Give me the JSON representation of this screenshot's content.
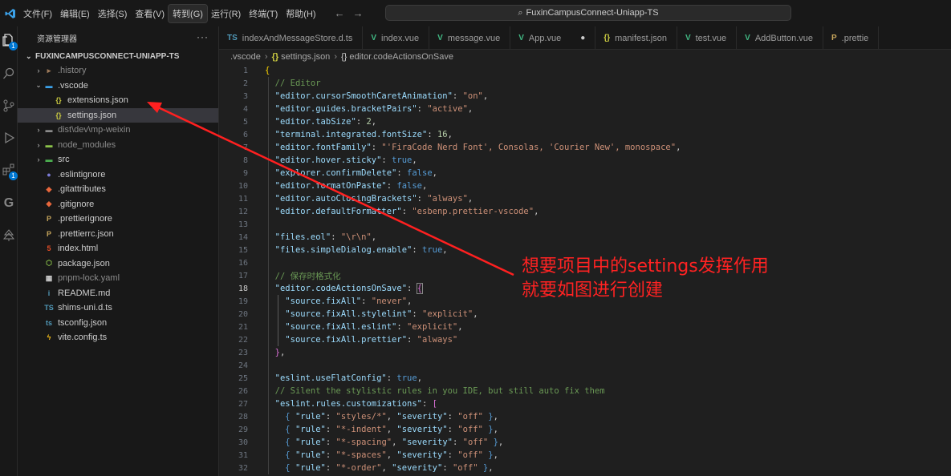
{
  "titlebar": {
    "menu": [
      "文件(F)",
      "编辑(E)",
      "选择(S)",
      "查看(V)",
      "转到(G)",
      "运行(R)",
      "终端(T)",
      "帮助(H)"
    ],
    "active_menu_index": 4,
    "search_text": "FuxinCampusConnect-Uniapp-TS"
  },
  "activitybar": {
    "explorer_badge": "1",
    "extensions_badge": "1"
  },
  "sidebar": {
    "header": "资源管理器",
    "more": "···",
    "project": "FUXINCAMPUSCONNECT-UNIAPP-TS",
    "tree": [
      {
        "label": ".history",
        "icon": "folder-history-icon",
        "level": 1,
        "chev": "›",
        "dim": true
      },
      {
        "label": ".vscode",
        "icon": "folder-vscode-icon",
        "level": 1,
        "chev": "⌄",
        "dim": false
      },
      {
        "label": "extensions.json",
        "icon": "json-braces-icon",
        "level": 2,
        "chev": "",
        "dim": false
      },
      {
        "label": "settings.json",
        "icon": "json-braces-icon",
        "level": 2,
        "chev": "",
        "dim": false,
        "selected": true
      },
      {
        "label": "dist\\dev\\mp-weixin",
        "icon": "folder-icon",
        "level": 1,
        "chev": "›",
        "dim": true
      },
      {
        "label": "node_modules",
        "icon": "folder-node-icon",
        "level": 1,
        "chev": "›",
        "dim": true
      },
      {
        "label": "src",
        "icon": "folder-src-icon",
        "level": 1,
        "chev": "›",
        "dim": false
      },
      {
        "label": ".eslintignore",
        "icon": "eslint-icon",
        "level": 1,
        "chev": "",
        "dim": false
      },
      {
        "label": ".gitattributes",
        "icon": "git-icon",
        "level": 1,
        "chev": "",
        "dim": false
      },
      {
        "label": ".gitignore",
        "icon": "git-icon",
        "level": 1,
        "chev": "",
        "dim": false
      },
      {
        "label": ".prettierignore",
        "icon": "prettier-icon",
        "level": 1,
        "chev": "",
        "dim": false
      },
      {
        "label": ".prettierrc.json",
        "icon": "prettier-icon",
        "level": 1,
        "chev": "",
        "dim": false
      },
      {
        "label": "index.html",
        "icon": "html-icon",
        "level": 1,
        "chev": "",
        "dim": false
      },
      {
        "label": "package.json",
        "icon": "nodejs-icon",
        "level": 1,
        "chev": "",
        "dim": false
      },
      {
        "label": "pnpm-lock.yaml",
        "icon": "pnpm-icon",
        "level": 1,
        "chev": "",
        "dim": true
      },
      {
        "label": "README.md",
        "icon": "info-icon",
        "level": 1,
        "chev": "",
        "dim": false
      },
      {
        "label": "shims-uni.d.ts",
        "icon": "ts-icon",
        "level": 1,
        "chev": "",
        "dim": false
      },
      {
        "label": "tsconfig.json",
        "icon": "tsconfig-icon",
        "level": 1,
        "chev": "",
        "dim": false
      },
      {
        "label": "vite.config.ts",
        "icon": "vite-icon",
        "level": 1,
        "chev": "",
        "dim": false
      }
    ]
  },
  "tabs": [
    {
      "label": "indexAndMessageStore.d.ts",
      "icon": "TS",
      "color": "#519aba"
    },
    {
      "label": "index.vue",
      "icon": "V",
      "color": "#41b883"
    },
    {
      "label": "message.vue",
      "icon": "V",
      "color": "#41b883"
    },
    {
      "label": "App.vue",
      "icon": "V",
      "color": "#41b883",
      "dirty": "●"
    },
    {
      "label": "manifest.json",
      "icon": "{}",
      "color": "#cbcb41"
    },
    {
      "label": "test.vue",
      "icon": "V",
      "color": "#41b883"
    },
    {
      "label": "AddButton.vue",
      "icon": "V",
      "color": "#41b883"
    },
    {
      "label": ".prettie",
      "icon": "P",
      "color": "#c6a55b"
    }
  ],
  "breadcrumb": [
    ".vscode",
    "settings.json",
    "editor.codeActionsOnSave"
  ],
  "editor": {
    "current_line": 18,
    "lines": [
      {
        "n": "1",
        "t": [
          [
            "br",
            "{"
          ]
        ]
      },
      {
        "n": "2",
        "t": [
          [
            "p",
            "  "
          ],
          [
            "c",
            "// Editor"
          ]
        ]
      },
      {
        "n": "3",
        "t": [
          [
            "p",
            "  "
          ],
          [
            "k",
            "\"editor.cursorSmoothCaretAnimation\""
          ],
          [
            "p",
            ": "
          ],
          [
            "s",
            "\"on\""
          ],
          [
            "p",
            ","
          ]
        ]
      },
      {
        "n": "4",
        "t": [
          [
            "p",
            "  "
          ],
          [
            "k",
            "\"editor.guides.bracketPairs\""
          ],
          [
            "p",
            ": "
          ],
          [
            "s",
            "\"active\""
          ],
          [
            "p",
            ","
          ]
        ]
      },
      {
        "n": "5",
        "t": [
          [
            "p",
            "  "
          ],
          [
            "k",
            "\"editor.tabSize\""
          ],
          [
            "p",
            ": "
          ],
          [
            "n",
            "2"
          ],
          [
            "p",
            ","
          ]
        ]
      },
      {
        "n": "6",
        "t": [
          [
            "p",
            "  "
          ],
          [
            "k",
            "\"terminal.integrated.fontSize\""
          ],
          [
            "p",
            ": "
          ],
          [
            "n",
            "16"
          ],
          [
            "p",
            ","
          ]
        ]
      },
      {
        "n": "7",
        "t": [
          [
            "p",
            "  "
          ],
          [
            "k",
            "\"editor.fontFamily\""
          ],
          [
            "p",
            ": "
          ],
          [
            "s",
            "\"'FiraCode Nerd Font', Consolas, 'Courier New', monospace\""
          ],
          [
            "p",
            ","
          ]
        ]
      },
      {
        "n": "8",
        "t": [
          [
            "p",
            "  "
          ],
          [
            "k",
            "\"editor.hover.sticky\""
          ],
          [
            "p",
            ": "
          ],
          [
            "b",
            "true"
          ],
          [
            "p",
            ","
          ]
        ]
      },
      {
        "n": "9",
        "t": [
          [
            "p",
            "  "
          ],
          [
            "k",
            "\"explorer.confirmDelete\""
          ],
          [
            "p",
            ": "
          ],
          [
            "b",
            "false"
          ],
          [
            "p",
            ","
          ]
        ]
      },
      {
        "n": "10",
        "t": [
          [
            "p",
            "  "
          ],
          [
            "k",
            "\"editor.formatOnPaste\""
          ],
          [
            "p",
            ": "
          ],
          [
            "b",
            "false"
          ],
          [
            "p",
            ","
          ]
        ]
      },
      {
        "n": "11",
        "t": [
          [
            "p",
            "  "
          ],
          [
            "k",
            "\"editor.autoClosingBrackets\""
          ],
          [
            "p",
            ": "
          ],
          [
            "s",
            "\"always\""
          ],
          [
            "p",
            ","
          ]
        ]
      },
      {
        "n": "12",
        "t": [
          [
            "p",
            "  "
          ],
          [
            "k",
            "\"editor.defaultFormatter\""
          ],
          [
            "p",
            ": "
          ],
          [
            "s",
            "\"esbenp.prettier-vscode\""
          ],
          [
            "p",
            ","
          ]
        ]
      },
      {
        "n": "13",
        "t": []
      },
      {
        "n": "14",
        "t": [
          [
            "p",
            "  "
          ],
          [
            "k",
            "\"files.eol\""
          ],
          [
            "p",
            ": "
          ],
          [
            "s",
            "\"\\r\\n\""
          ],
          [
            "p",
            ","
          ]
        ]
      },
      {
        "n": "15",
        "t": [
          [
            "p",
            "  "
          ],
          [
            "k",
            "\"files.simpleDialog.enable\""
          ],
          [
            "p",
            ": "
          ],
          [
            "b",
            "true"
          ],
          [
            "p",
            ","
          ]
        ]
      },
      {
        "n": "16",
        "t": []
      },
      {
        "n": "17",
        "t": [
          [
            "p",
            "  "
          ],
          [
            "c",
            "// 保存时格式化"
          ]
        ]
      },
      {
        "n": "18",
        "t": [
          [
            "p",
            "  "
          ],
          [
            "k",
            "\"editor.codeActionsOnSave\""
          ],
          [
            "p",
            ": "
          ],
          [
            "br2",
            "{"
          ]
        ]
      },
      {
        "n": "19",
        "t": [
          [
            "p",
            "    "
          ],
          [
            "k",
            "\"source.fixAll\""
          ],
          [
            "p",
            ": "
          ],
          [
            "s",
            "\"never\""
          ],
          [
            "p",
            ","
          ]
        ]
      },
      {
        "n": "20",
        "t": [
          [
            "p",
            "    "
          ],
          [
            "k",
            "\"source.fixAll.stylelint\""
          ],
          [
            "p",
            ": "
          ],
          [
            "s",
            "\"explicit\""
          ],
          [
            "p",
            ","
          ]
        ]
      },
      {
        "n": "21",
        "t": [
          [
            "p",
            "    "
          ],
          [
            "k",
            "\"source.fixAll.eslint\""
          ],
          [
            "p",
            ": "
          ],
          [
            "s",
            "\"explicit\""
          ],
          [
            "p",
            ","
          ]
        ]
      },
      {
        "n": "22",
        "t": [
          [
            "p",
            "    "
          ],
          [
            "k",
            "\"source.fixAll.prettier\""
          ],
          [
            "p",
            ": "
          ],
          [
            "s",
            "\"always\""
          ]
        ]
      },
      {
        "n": "23",
        "t": [
          [
            "p",
            "  "
          ],
          [
            "br2",
            "}"
          ],
          [
            "p",
            ","
          ]
        ]
      },
      {
        "n": "24",
        "t": []
      },
      {
        "n": "25",
        "t": [
          [
            "p",
            "  "
          ],
          [
            "k",
            "\"eslint.useFlatConfig\""
          ],
          [
            "p",
            ": "
          ],
          [
            "b",
            "true"
          ],
          [
            "p",
            ","
          ]
        ]
      },
      {
        "n": "26",
        "t": [
          [
            "p",
            "  "
          ],
          [
            "c",
            "// Silent the stylistic rules in you IDE, but still auto fix them"
          ]
        ]
      },
      {
        "n": "27",
        "t": [
          [
            "p",
            "  "
          ],
          [
            "k",
            "\"eslint.rules.customizations\""
          ],
          [
            "p",
            ": "
          ],
          [
            "br2",
            "["
          ]
        ]
      },
      {
        "n": "28",
        "t": [
          [
            "p",
            "    "
          ],
          [
            "b",
            "{"
          ],
          [
            "p",
            " "
          ],
          [
            "k",
            "\"rule\""
          ],
          [
            "p",
            ": "
          ],
          [
            "s",
            "\"styles/*\""
          ],
          [
            "p",
            ", "
          ],
          [
            "k",
            "\"severity\""
          ],
          [
            "p",
            ": "
          ],
          [
            "s",
            "\"off\""
          ],
          [
            "p",
            " "
          ],
          [
            "b",
            "}"
          ],
          [
            "p",
            ","
          ]
        ]
      },
      {
        "n": "29",
        "t": [
          [
            "p",
            "    "
          ],
          [
            "b",
            "{"
          ],
          [
            "p",
            " "
          ],
          [
            "k",
            "\"rule\""
          ],
          [
            "p",
            ": "
          ],
          [
            "s",
            "\"*-indent\""
          ],
          [
            "p",
            ", "
          ],
          [
            "k",
            "\"severity\""
          ],
          [
            "p",
            ": "
          ],
          [
            "s",
            "\"off\""
          ],
          [
            "p",
            " "
          ],
          [
            "b",
            "}"
          ],
          [
            "p",
            ","
          ]
        ]
      },
      {
        "n": "30",
        "t": [
          [
            "p",
            "    "
          ],
          [
            "b",
            "{"
          ],
          [
            "p",
            " "
          ],
          [
            "k",
            "\"rule\""
          ],
          [
            "p",
            ": "
          ],
          [
            "s",
            "\"*-spacing\""
          ],
          [
            "p",
            ", "
          ],
          [
            "k",
            "\"severity\""
          ],
          [
            "p",
            ": "
          ],
          [
            "s",
            "\"off\""
          ],
          [
            "p",
            " "
          ],
          [
            "b",
            "}"
          ],
          [
            "p",
            ","
          ]
        ]
      },
      {
        "n": "31",
        "t": [
          [
            "p",
            "    "
          ],
          [
            "b",
            "{"
          ],
          [
            "p",
            " "
          ],
          [
            "k",
            "\"rule\""
          ],
          [
            "p",
            ": "
          ],
          [
            "s",
            "\"*-spaces\""
          ],
          [
            "p",
            ", "
          ],
          [
            "k",
            "\"severity\""
          ],
          [
            "p",
            ": "
          ],
          [
            "s",
            "\"off\""
          ],
          [
            "p",
            " "
          ],
          [
            "b",
            "}"
          ],
          [
            "p",
            ","
          ]
        ]
      },
      {
        "n": "32",
        "t": [
          [
            "p",
            "    "
          ],
          [
            "b",
            "{"
          ],
          [
            "p",
            " "
          ],
          [
            "k",
            "\"rule\""
          ],
          [
            "p",
            ": "
          ],
          [
            "s",
            "\"*-order\""
          ],
          [
            "p",
            ", "
          ],
          [
            "k",
            "\"severity\""
          ],
          [
            "p",
            ": "
          ],
          [
            "s",
            "\"off\""
          ],
          [
            "p",
            " "
          ],
          [
            "b",
            "}"
          ],
          [
            "p",
            ","
          ]
        ]
      }
    ]
  },
  "annotation": {
    "line1": "想要项目中的settings发挥作用",
    "line2": "就要如图进行创建",
    "color": "#ff2222"
  }
}
